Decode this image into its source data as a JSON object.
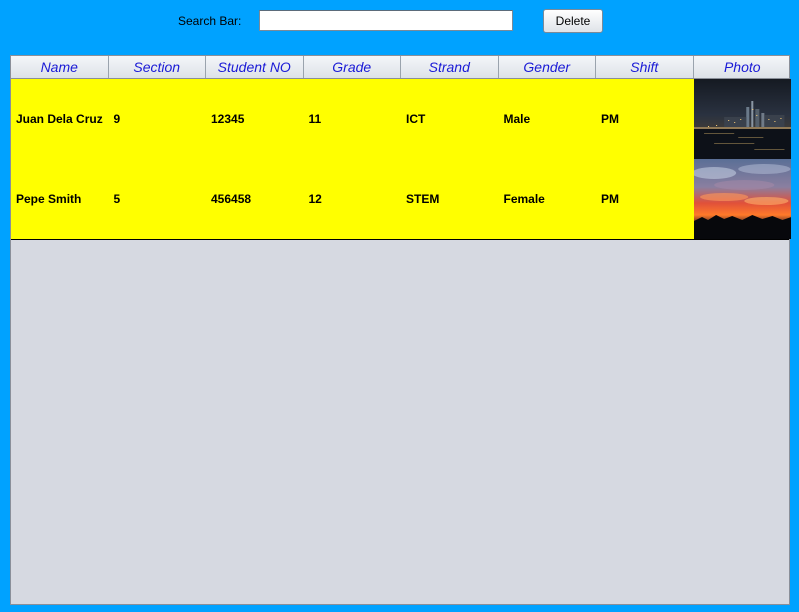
{
  "search": {
    "label": "Search Bar:",
    "value": "",
    "placeholder": ""
  },
  "toolbar": {
    "delete_label": "Delete"
  },
  "table": {
    "columns": [
      "Name",
      "Section",
      "Student NO",
      "Grade",
      "Strand",
      "Gender",
      "Shift",
      "Photo"
    ],
    "rows": [
      {
        "name": "Juan Dela Cruz",
        "section": "9",
        "student_no": "12345",
        "grade": "11",
        "strand": "ICT",
        "gender": "Male",
        "shift": "PM",
        "photo": "city-night-skyline"
      },
      {
        "name": "Pepe Smith",
        "section": "5",
        "student_no": "456458",
        "grade": "12",
        "strand": "STEM",
        "gender": "Female",
        "shift": "PM",
        "photo": "sunset-sky"
      }
    ]
  },
  "colors": {
    "window_background": "#00a2ff",
    "row_highlight": "#ffff00",
    "header_text": "#1a1ad6",
    "panel_background": "#d6d9e1"
  }
}
